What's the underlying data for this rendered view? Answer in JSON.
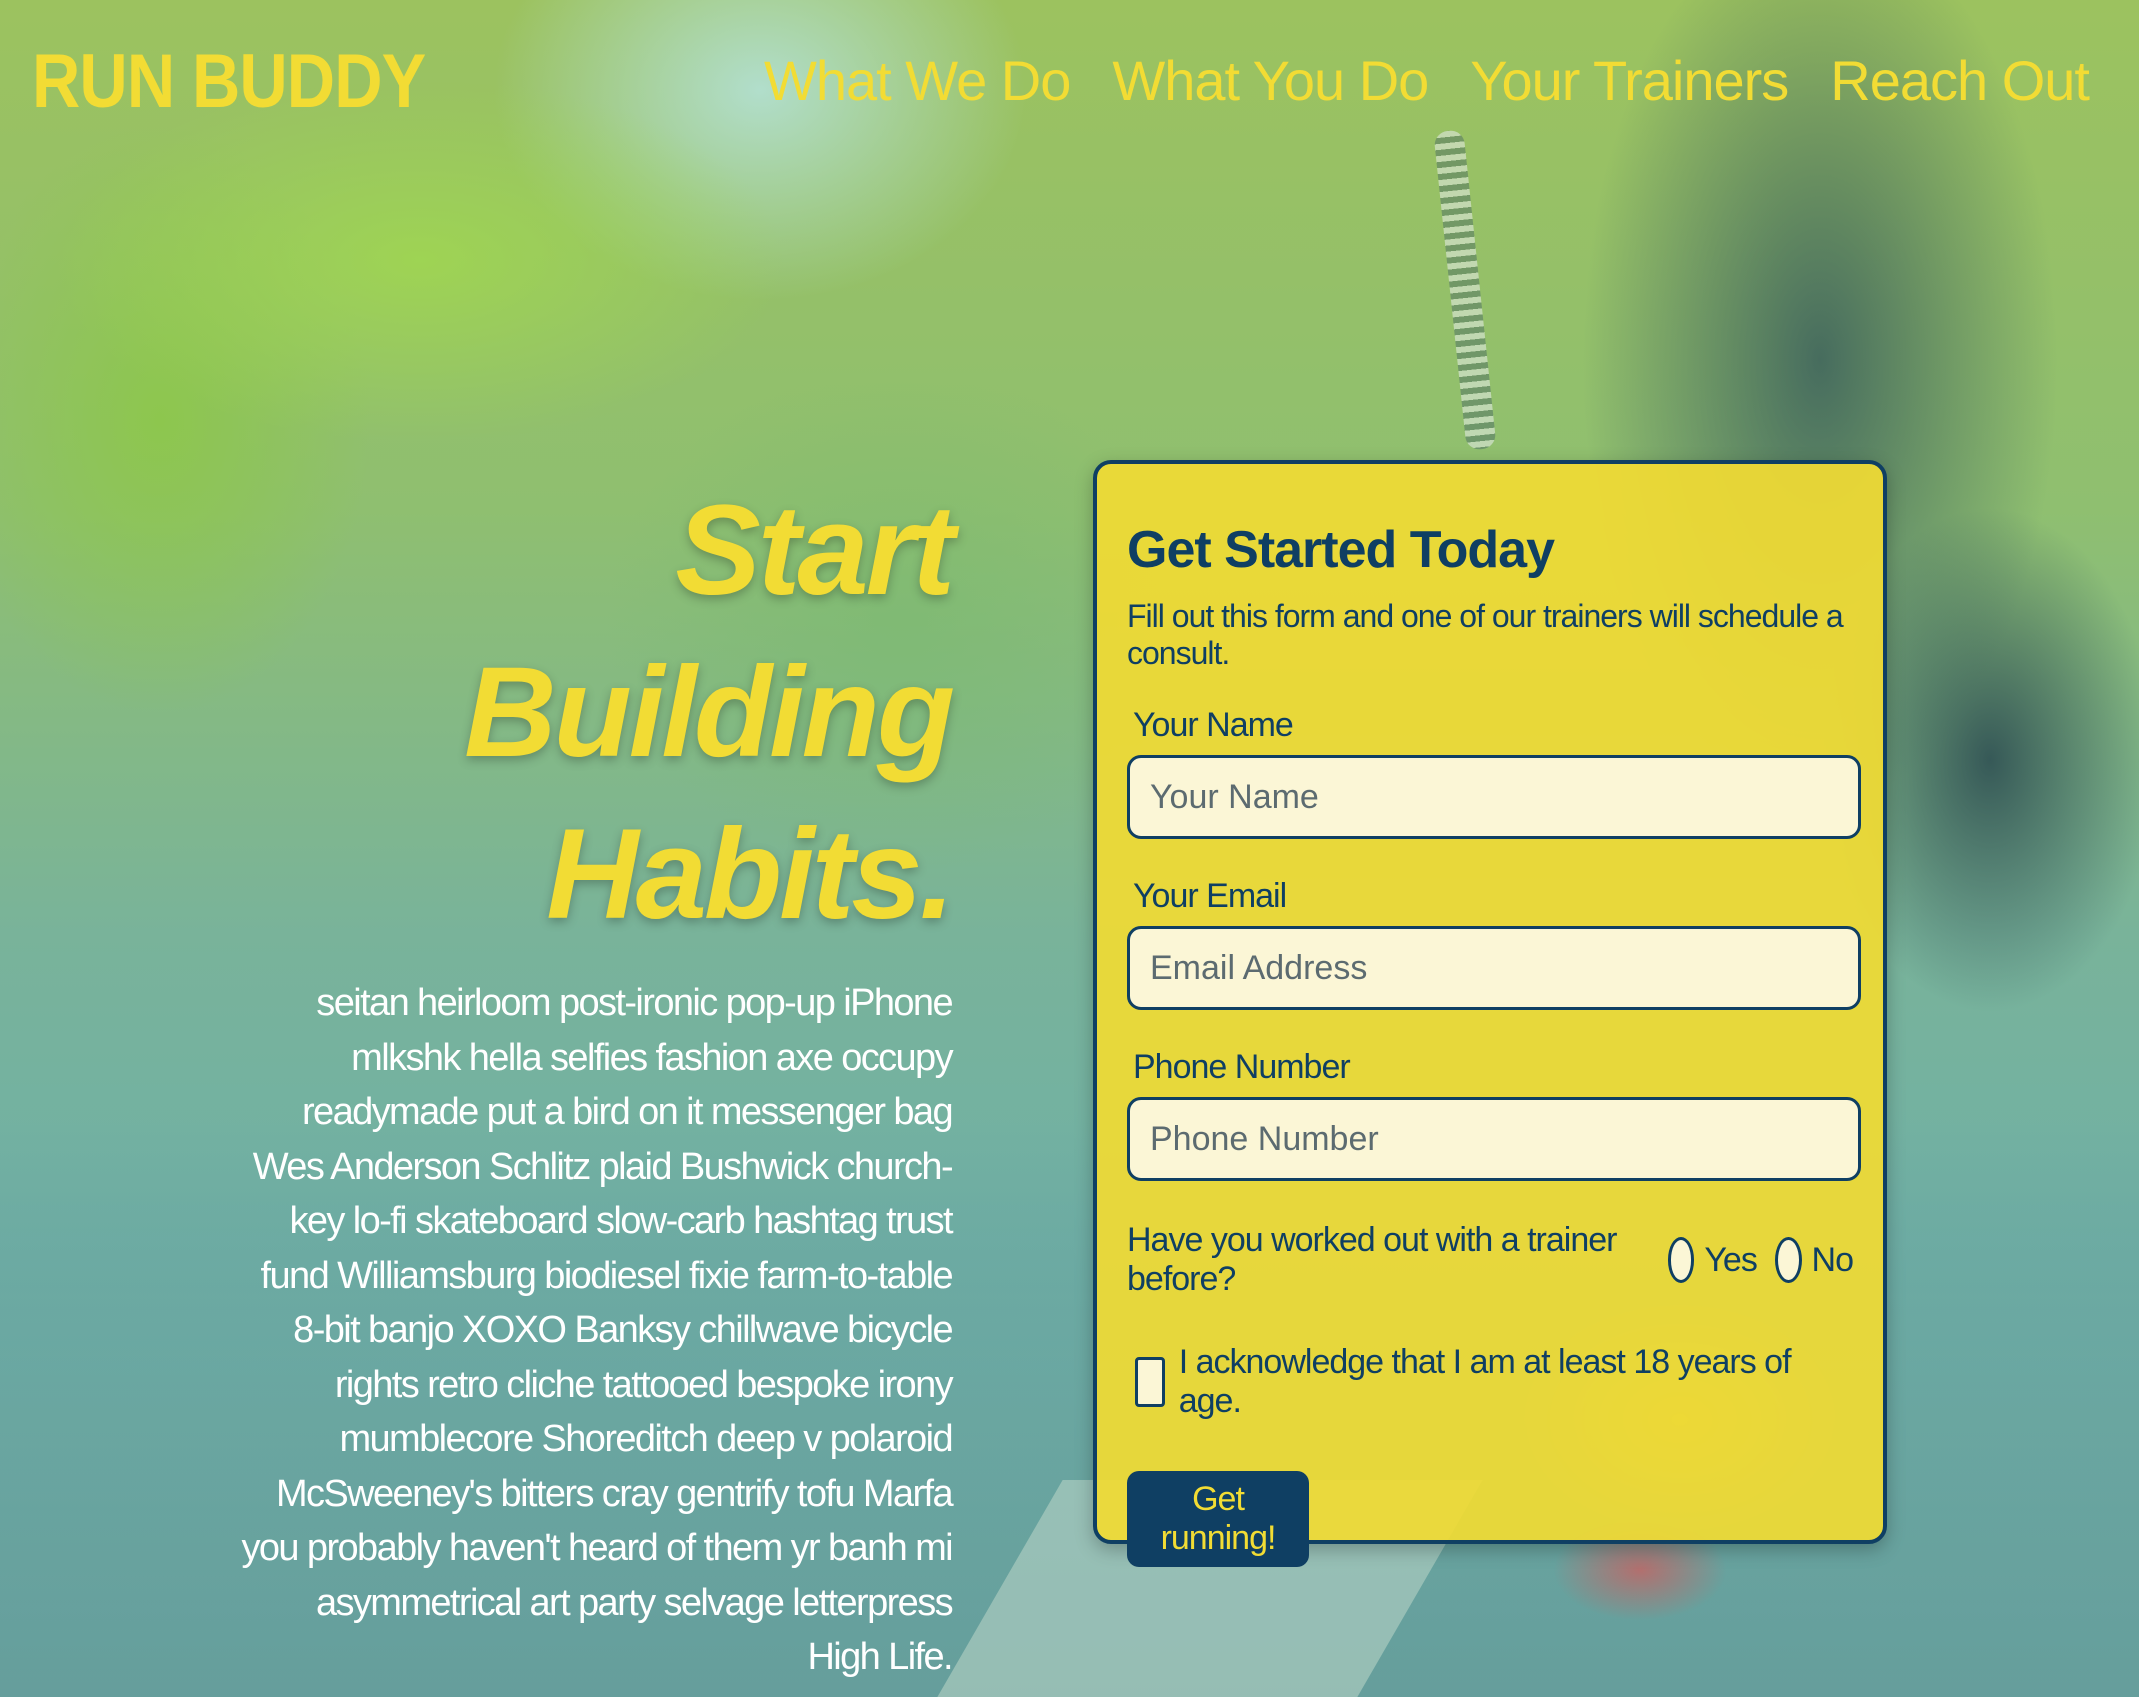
{
  "header": {
    "logo": "RUN BUDDY",
    "nav": [
      {
        "label": "What We Do"
      },
      {
        "label": "What You Do"
      },
      {
        "label": "Your Trainers"
      },
      {
        "label": "Reach Out"
      }
    ]
  },
  "hero": {
    "title_line1": "Start Building",
    "title_line2": "Habits.",
    "body": "seitan heirloom post-ironic pop-up iPhone mlkshk hella selfies fashion axe occupy readymade put a bird on it messenger bag Wes Anderson Schlitz plaid Bushwick church-key lo-fi skateboard slow-carb hashtag trust fund Williamsburg biodiesel fixie farm-to-table 8-bit banjo XOXO Banksy chillwave bicycle rights retro cliche tattooed bespoke irony mumblecore Shoreditch deep v polaroid McSweeney's bitters cray gentrify tofu Marfa you probably haven't heard of them yr banh mi asymmetrical art party selvage letterpress High Life."
  },
  "form": {
    "title": "Get Started Today",
    "subtitle": "Fill out this form and one of our trainers will schedule a consult.",
    "name_label": "Your Name",
    "name_placeholder": "Your Name",
    "email_label": "Your Email",
    "email_placeholder": "Email Address",
    "phone_label": "Phone Number",
    "phone_placeholder": "Phone Number",
    "trainer_question": "Have you worked out with a trainer before?",
    "radio_yes": "Yes",
    "radio_no": "No",
    "age_ack": "I acknowledge that I am at least 18 years of age.",
    "submit": "Get running!"
  },
  "colors": {
    "accent_yellow": "#f2dc34",
    "navy": "#0f3f63",
    "input_bg": "#fbf6d6"
  }
}
